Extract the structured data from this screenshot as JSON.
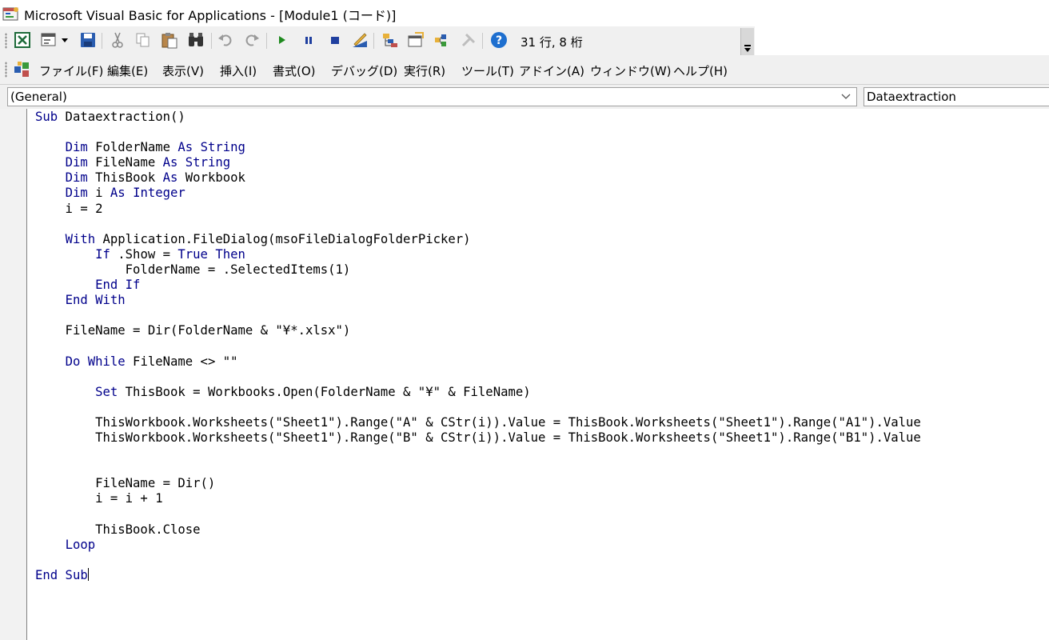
{
  "window": {
    "title": "Microsoft Visual Basic for Applications - [Module1 (コード)]"
  },
  "toolbar": {
    "buttons": [
      {
        "name": "view-excel-icon",
        "tooltip": "Excel"
      },
      {
        "name": "insert-userform-icon",
        "tooltip": "UserForm"
      },
      {
        "name": "save-icon",
        "tooltip": "Save"
      },
      {
        "name": "cut-icon",
        "tooltip": "Cut"
      },
      {
        "name": "copy-icon",
        "tooltip": "Copy"
      },
      {
        "name": "paste-icon",
        "tooltip": "Paste"
      },
      {
        "name": "find-icon",
        "tooltip": "Find"
      },
      {
        "name": "undo-icon",
        "tooltip": "Undo"
      },
      {
        "name": "redo-icon",
        "tooltip": "Redo"
      },
      {
        "name": "run-icon",
        "tooltip": "Run"
      },
      {
        "name": "break-icon",
        "tooltip": "Break"
      },
      {
        "name": "reset-icon",
        "tooltip": "Reset"
      },
      {
        "name": "design-mode-icon",
        "tooltip": "Design Mode"
      },
      {
        "name": "project-explorer-icon",
        "tooltip": "Project Explorer"
      },
      {
        "name": "properties-window-icon",
        "tooltip": "Properties"
      },
      {
        "name": "object-browser-icon",
        "tooltip": "Object Browser"
      },
      {
        "name": "toolbox-icon",
        "tooltip": "Toolbox"
      },
      {
        "name": "help-icon",
        "tooltip": "Help"
      }
    ],
    "status": "31 行, 8 桁",
    "colors": {
      "run": "#1f8a1f",
      "pause": "#1f3f9f",
      "stop": "#1f3f9f",
      "help": "#1e6fcf"
    }
  },
  "menu": {
    "items": [
      "ファイル(F)",
      "編集(E)",
      "表示(V)",
      "挿入(I)",
      "書式(O)",
      "デバッグ(D)",
      "実行(R)",
      "ツール(T)",
      "アドイン(A)",
      "ウィンドウ(W)",
      "ヘルプ(H)"
    ]
  },
  "editor": {
    "object_combo": "(General)",
    "procedure_combo": "Dataextraction",
    "code_lines": [
      [
        {
          "t": "Sub",
          "k": 1
        },
        {
          "t": " Dataextraction()"
        }
      ],
      [
        {
          "t": ""
        }
      ],
      [
        {
          "t": "    "
        },
        {
          "t": "Dim",
          "k": 1
        },
        {
          "t": " FolderName "
        },
        {
          "t": "As String",
          "k": 1
        }
      ],
      [
        {
          "t": "    "
        },
        {
          "t": "Dim",
          "k": 1
        },
        {
          "t": " FileName "
        },
        {
          "t": "As String",
          "k": 1
        }
      ],
      [
        {
          "t": "    "
        },
        {
          "t": "Dim",
          "k": 1
        },
        {
          "t": " ThisBook "
        },
        {
          "t": "As",
          "k": 1
        },
        {
          "t": " Workbook"
        }
      ],
      [
        {
          "t": "    "
        },
        {
          "t": "Dim",
          "k": 1
        },
        {
          "t": " i "
        },
        {
          "t": "As Integer",
          "k": 1
        }
      ],
      [
        {
          "t": "    i = 2"
        }
      ],
      [
        {
          "t": ""
        }
      ],
      [
        {
          "t": "    "
        },
        {
          "t": "With",
          "k": 1
        },
        {
          "t": " Application.FileDialog(msoFileDialogFolderPicker)"
        }
      ],
      [
        {
          "t": "        "
        },
        {
          "t": "If",
          "k": 1
        },
        {
          "t": " .Show = "
        },
        {
          "t": "True Then",
          "k": 1
        }
      ],
      [
        {
          "t": "            FolderName = .SelectedItems(1)"
        }
      ],
      [
        {
          "t": "        "
        },
        {
          "t": "End If",
          "k": 1
        }
      ],
      [
        {
          "t": "    "
        },
        {
          "t": "End With",
          "k": 1
        }
      ],
      [
        {
          "t": ""
        }
      ],
      [
        {
          "t": "    FileName = Dir(FolderName & \"¥*.xlsx\")"
        }
      ],
      [
        {
          "t": ""
        }
      ],
      [
        {
          "t": "    "
        },
        {
          "t": "Do While",
          "k": 1
        },
        {
          "t": " FileName <> \"\""
        }
      ],
      [
        {
          "t": ""
        }
      ],
      [
        {
          "t": "        "
        },
        {
          "t": "Set",
          "k": 1
        },
        {
          "t": " ThisBook = Workbooks.Open(FolderName & \"¥\" & FileName)"
        }
      ],
      [
        {
          "t": ""
        }
      ],
      [
        {
          "t": "        ThisWorkbook.Worksheets(\"Sheet1\").Range(\"A\" & CStr(i)).Value = ThisBook.Worksheets(\"Sheet1\").Range(\"A1\").Value"
        }
      ],
      [
        {
          "t": "        ThisWorkbook.Worksheets(\"Sheet1\").Range(\"B\" & CStr(i)).Value = ThisBook.Worksheets(\"Sheet1\").Range(\"B1\").Value"
        }
      ],
      [
        {
          "t": ""
        }
      ],
      [
        {
          "t": ""
        }
      ],
      [
        {
          "t": "        FileName = Dir()"
        }
      ],
      [
        {
          "t": "        i = i + 1"
        }
      ],
      [
        {
          "t": ""
        }
      ],
      [
        {
          "t": "        ThisBook.Close"
        }
      ],
      [
        {
          "t": "    "
        },
        {
          "t": "Loop",
          "k": 1
        }
      ],
      [
        {
          "t": ""
        }
      ],
      [
        {
          "t": "End Sub",
          "k": 1,
          "caret": 1
        }
      ]
    ],
    "keyword_color": "#00008b",
    "text_color": "#000000"
  }
}
